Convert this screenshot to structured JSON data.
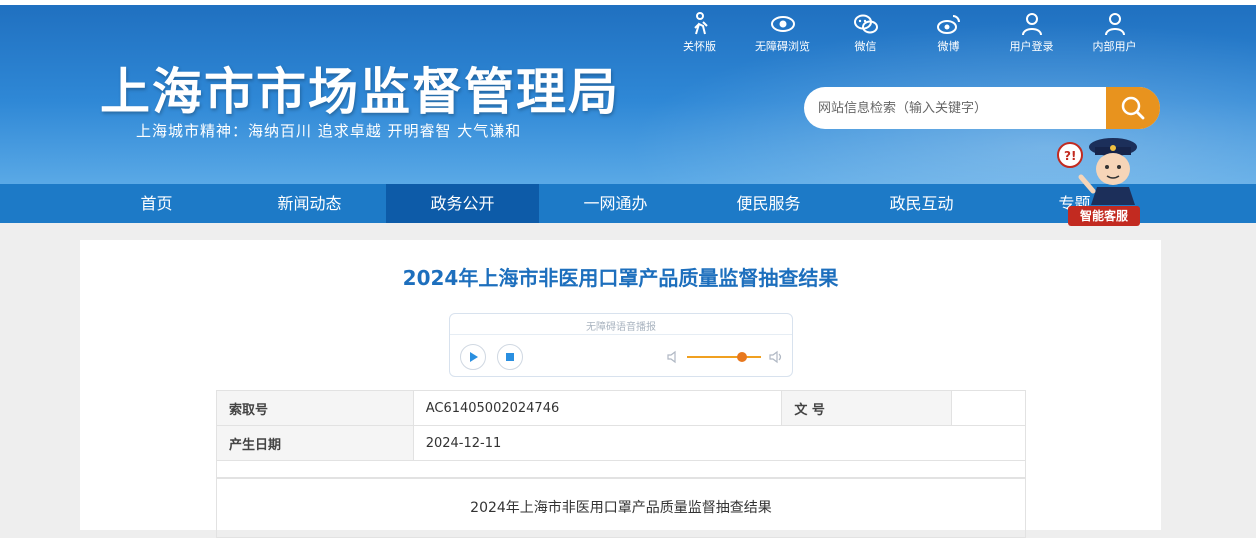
{
  "header": {
    "title": "上海市市场监督管理局",
    "motto": "上海城市精神：海纳百川   追求卓越   开明睿智   大气谦和",
    "tools": [
      {
        "label": "关怀版",
        "icon": "elderly-care-icon"
      },
      {
        "label": "无障碍浏览",
        "icon": "eye-icon"
      },
      {
        "label": "微信",
        "icon": "wechat-icon"
      },
      {
        "label": "微博",
        "icon": "weibo-icon"
      },
      {
        "label": "用户登录",
        "icon": "user-icon"
      },
      {
        "label": "内部用户",
        "icon": "user-icon"
      }
    ],
    "search_placeholder": "网站信息检索（输入关键字）",
    "accent": "#e8931e"
  },
  "nav": {
    "items": [
      "首页",
      "新闻动态",
      "政务公开",
      "一网通办",
      "便民服务",
      "政民互动",
      "专题"
    ],
    "active": "政务公开"
  },
  "assistant": {
    "label": "智能客服"
  },
  "article": {
    "title": "2024年上海市非医用口罩产品质量监督抽查结果",
    "player_label": "无障碍语音播报",
    "meta": {
      "index_label": "索取号",
      "index_value": "AC61405002024746",
      "doc_label": "文  号",
      "doc_value": "",
      "date_label": "产生日期",
      "date_value": "2024-12-11"
    },
    "body_title": "2024年上海市非医用口罩产品质量监督抽查结果"
  }
}
